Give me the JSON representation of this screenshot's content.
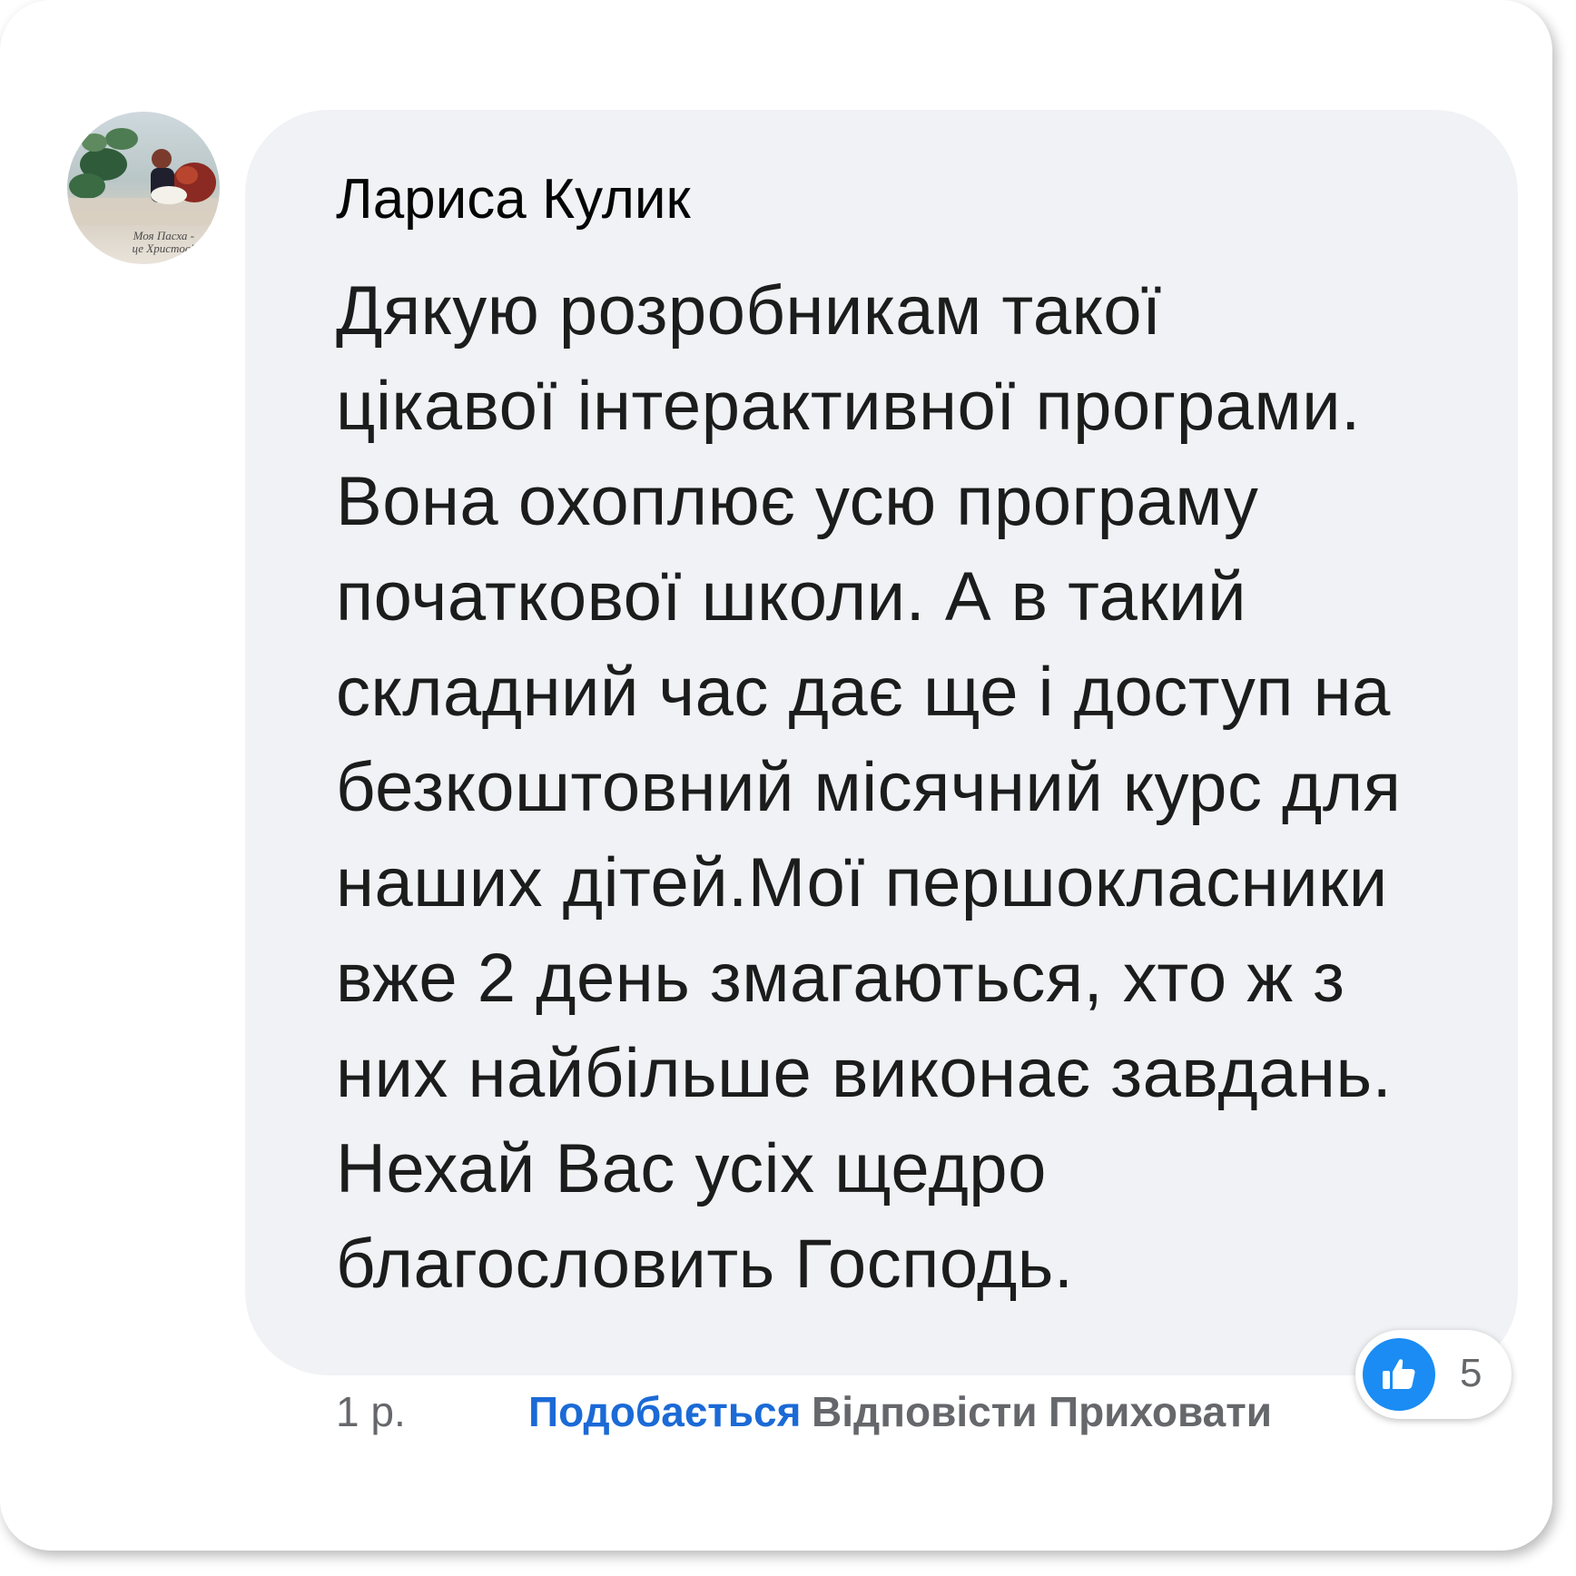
{
  "comment": {
    "author": "Лариса Кулик",
    "avatar_caption": [
      "Моя Пасха -",
      "це Христос!"
    ],
    "text_lines": [
      "Дякую розробникам такої",
      "цікавої інтерактивної програми.",
      "Вона охоплює усю програму",
      "початкової школи. А в такий",
      "складний час дає ще і доступ на",
      "безкоштовний місячний курс для",
      "наших дітей.Мої першокласники",
      "вже 2 день змагаються, хто ж з",
      "них найбільше виконає завдань.",
      "Нехай Вас усіх щедро",
      "благословить Господь."
    ]
  },
  "actions": {
    "time": "1 р.",
    "like": "Подобається",
    "reply": "Відповісти",
    "hide": "Приховати"
  },
  "reactions": {
    "icon": "thumbs-up-icon",
    "count": "5"
  },
  "colors": {
    "bubble": "#f0f2f5",
    "like_active": "#1b6ad6",
    "like_badge": "#1a8cf3",
    "muted": "#65676b"
  }
}
